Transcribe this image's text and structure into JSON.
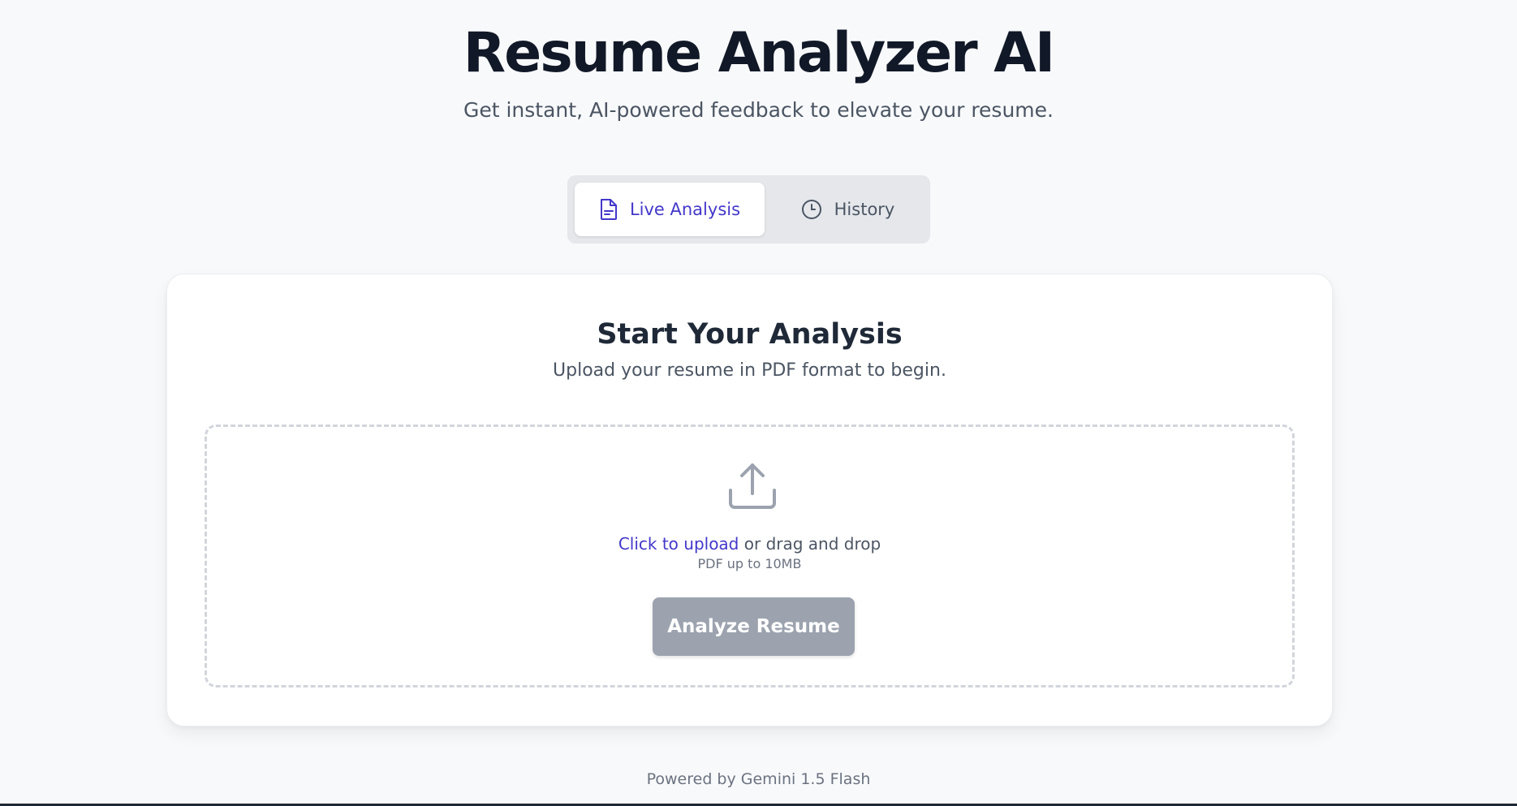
{
  "header": {
    "title": "Resume Analyzer AI",
    "subtitle": "Get instant, AI-powered feedback to elevate your resume."
  },
  "tabs": [
    {
      "label": "Live Analysis",
      "icon": "document-icon",
      "active": true
    },
    {
      "label": "History",
      "icon": "clock-icon",
      "active": false
    }
  ],
  "analysis_card": {
    "title": "Start Your Analysis",
    "subtitle": "Upload your resume in PDF format to begin.",
    "upload": {
      "icon": "upload-icon",
      "link_text": "Click to upload",
      "rest_text": " or drag and drop",
      "hint": "PDF up to 10MB"
    },
    "analyze_button_label": "Analyze Resume"
  },
  "footer": {
    "text": "Powered by Gemini 1.5 Flash"
  },
  "colors": {
    "accent": "#4338ca",
    "background": "#f8f9fb",
    "button_disabled": "#9ca3af",
    "dropzone_border": "#d1d5db"
  }
}
